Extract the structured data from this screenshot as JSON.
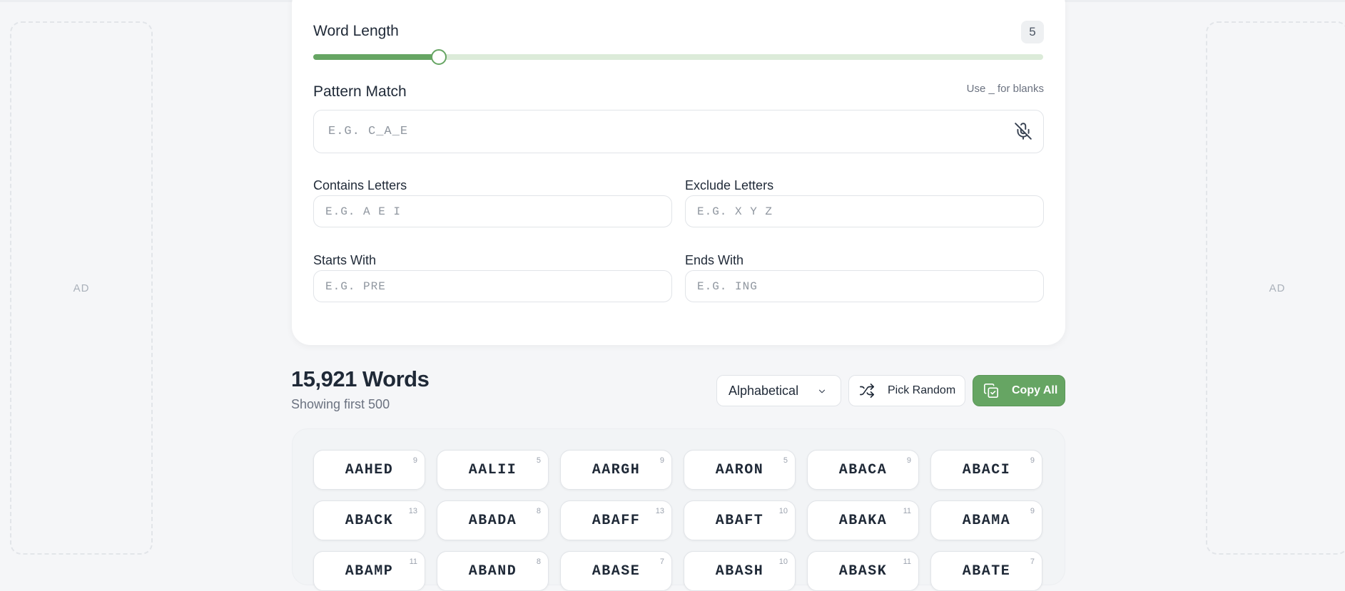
{
  "ads": {
    "left": "AD",
    "right": "AD"
  },
  "filters": {
    "word_length": {
      "label": "Word Length",
      "value": "5",
      "fill_fraction": 0.172
    },
    "pattern": {
      "label": "Pattern Match",
      "hint": "Use _ for blanks",
      "placeholder": "E.G. C_A_E"
    },
    "contains": {
      "label": "Contains Letters",
      "placeholder": "E.G. A E I"
    },
    "exclude": {
      "label": "Exclude Letters",
      "placeholder": "E.G. X Y Z"
    },
    "starts": {
      "label": "Starts With",
      "placeholder": "E.G. PRE"
    },
    "ends": {
      "label": "Ends With",
      "placeholder": "E.G. ING"
    }
  },
  "results": {
    "title": "15,921 Words",
    "subtitle": "Showing first 500",
    "sort_label": "Alphabetical",
    "pick_random_label": "Pick Random",
    "copy_all_label": "Copy All"
  },
  "accent_color": "#66a563",
  "icons": {
    "mic": "mic-off-icon",
    "sort": "chevron-down-icon",
    "pick": "shuffle-icon",
    "copy": "copy-icon"
  },
  "words": [
    {
      "word": "AAHED",
      "score": "9"
    },
    {
      "word": "AALII",
      "score": "5"
    },
    {
      "word": "AARGH",
      "score": "9"
    },
    {
      "word": "AARON",
      "score": "5"
    },
    {
      "word": "ABACA",
      "score": "9"
    },
    {
      "word": "ABACI",
      "score": "9"
    },
    {
      "word": "ABACK",
      "score": "13"
    },
    {
      "word": "ABADA",
      "score": "8"
    },
    {
      "word": "ABAFF",
      "score": "13"
    },
    {
      "word": "ABAFT",
      "score": "10"
    },
    {
      "word": "ABAKA",
      "score": "11"
    },
    {
      "word": "ABAMA",
      "score": "9"
    },
    {
      "word": "ABAMP",
      "score": "11"
    },
    {
      "word": "ABAND",
      "score": "8"
    },
    {
      "word": "ABASE",
      "score": "7"
    },
    {
      "word": "ABASH",
      "score": "10"
    },
    {
      "word": "ABASK",
      "score": "11"
    },
    {
      "word": "ABATE",
      "score": "7"
    }
  ]
}
